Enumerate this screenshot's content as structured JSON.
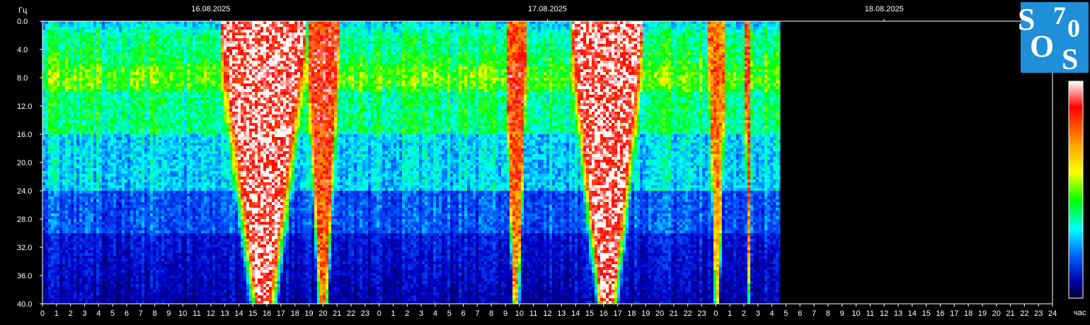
{
  "chart_data": {
    "type": "heatmap",
    "ylabel": "Гц",
    "xlabel": "час",
    "ylim": [
      0,
      40
    ],
    "y_ticks": [
      "0.0",
      "4.0",
      "8.0",
      "12.0",
      "16.0",
      "20.0",
      "24.0",
      "28.0",
      "32.0",
      "36.0",
      "40.0"
    ],
    "dates": [
      "16.08.2025",
      "17.08.2025",
      "18.08.2025"
    ],
    "x_ticks": [
      "0",
      "1",
      "2",
      "3",
      "4",
      "5",
      "6",
      "7",
      "8",
      "9",
      "10",
      "11",
      "12",
      "13",
      "14",
      "15",
      "16",
      "17",
      "18",
      "19",
      "20",
      "21",
      "22",
      "23",
      "0",
      "1",
      "2",
      "3",
      "4",
      "5",
      "6",
      "7",
      "8",
      "9",
      "10",
      "11",
      "12",
      "13",
      "14",
      "15",
      "16",
      "17",
      "18",
      "19",
      "20",
      "21",
      "22",
      "23",
      "0",
      "1",
      "2",
      "3",
      "4",
      "5",
      "6",
      "7",
      "8",
      "9",
      "10",
      "11",
      "12",
      "13",
      "14",
      "15",
      "16",
      "17",
      "18",
      "19",
      "20",
      "21",
      "22",
      "23",
      "24"
    ],
    "xlim_hours": [
      0,
      72
    ],
    "data_end_hour": 52.6,
    "intensity_bursts": [
      {
        "start_hour": 12.7,
        "end_hour": 18.6,
        "level": 1.0
      },
      {
        "start_hour": 18.8,
        "end_hour": 21.0,
        "level": 0.85
      },
      {
        "start_hour": 32.9,
        "end_hour": 34.4,
        "level": 0.8
      },
      {
        "start_hour": 37.7,
        "end_hour": 42.6,
        "level": 1.0
      },
      {
        "start_hour": 47.4,
        "end_hour": 48.6,
        "level": 0.7
      },
      {
        "start_hour": 50.0,
        "end_hour": 50.4,
        "level": 0.8
      }
    ],
    "colorbar": [
      "#ffffff",
      "#ff0000",
      "#ffaa00",
      "#ffff00",
      "#00ff00",
      "#00ffff",
      "#0066ff",
      "#0000aa",
      "#000033"
    ],
    "logo": {
      "s1": "S",
      "seven": "7",
      "zero": "0",
      "o": "O",
      "s2": "S",
      "color": "#1e8fd8"
    }
  }
}
